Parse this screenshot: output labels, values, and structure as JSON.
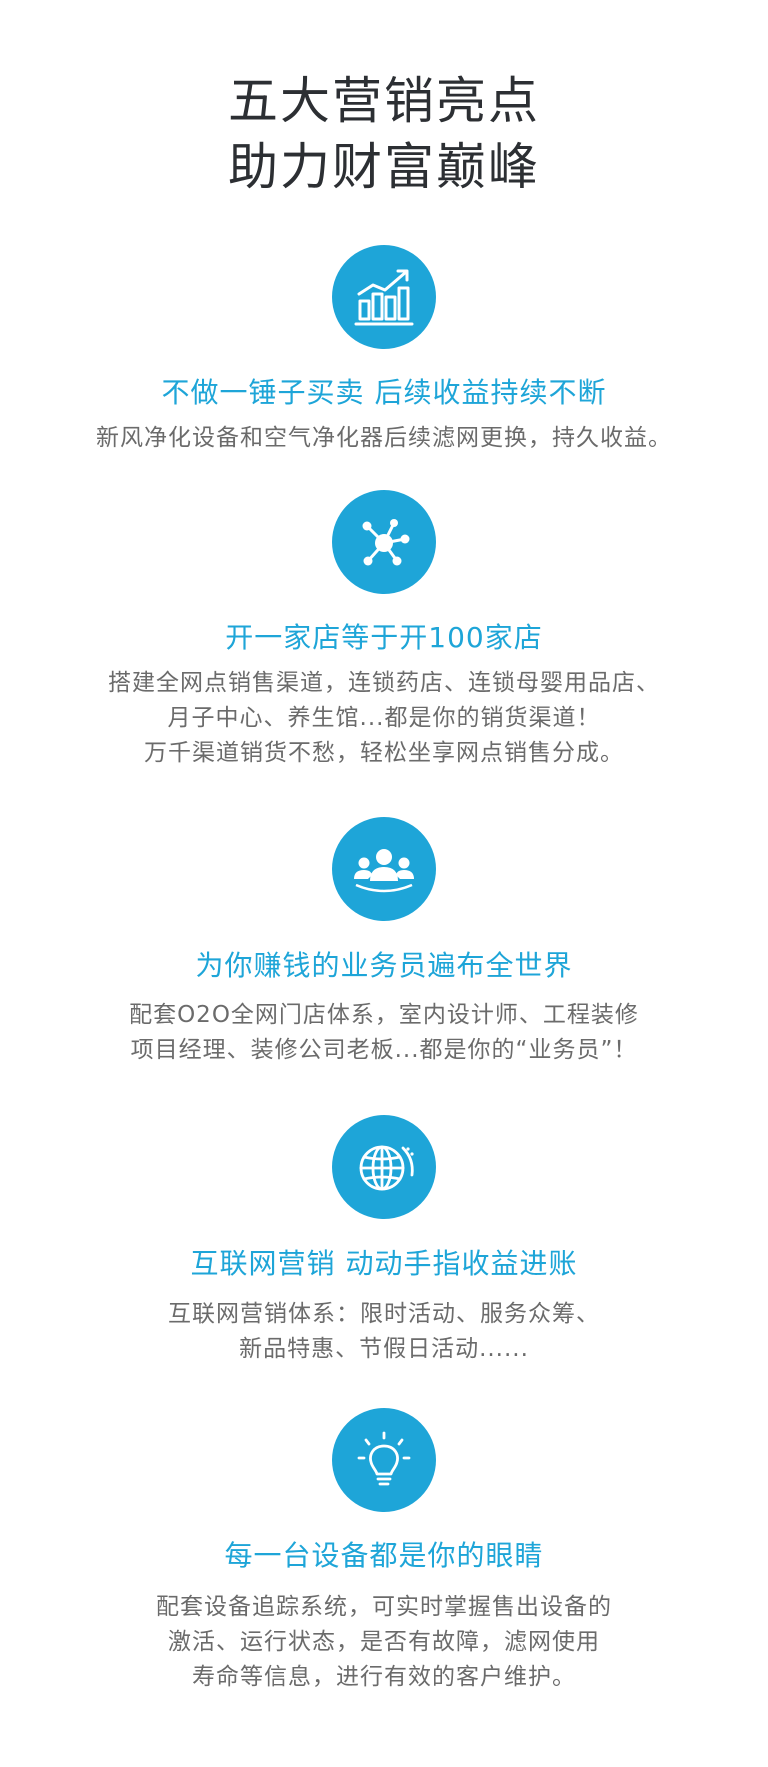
{
  "header": {
    "line1": "五大营销亮点",
    "line2": "助力财富巅峰"
  },
  "colors": {
    "accent": "#1ea5d8",
    "title_text": "#2c2f33",
    "body_text": "#6b6b6b"
  },
  "features": [
    {
      "icon": "growth-chart-icon",
      "title": "不做一锤子买卖 后续收益持续不断",
      "lines": [
        "新风净化设备和空气净化器后续滤网更换，持久收益。"
      ]
    },
    {
      "icon": "network-nodes-icon",
      "title": "开一家店等于开100家店",
      "lines": [
        "搭建全网点销售渠道，连锁药店、连锁母婴用品店、",
        "月子中心、养生馆...都是你的销货渠道！",
        "万千渠道销货不愁，轻松坐享网点销售分成。"
      ]
    },
    {
      "icon": "team-people-icon",
      "title": "为你赚钱的业务员遍布全世界",
      "lines": [
        "配套O2O全网门店体系，室内设计师、工程装修",
        "项目经理、装修公司老板...都是你的“业务员”！"
      ]
    },
    {
      "icon": "globe-icon",
      "title": "互联网营销 动动手指收益进账",
      "lines": [
        "互联网营销体系：限时活动、服务众筹、",
        "新品特惠、节假日活动......"
      ]
    },
    {
      "icon": "lightbulb-icon",
      "title": "每一台设备都是你的眼睛",
      "lines": [
        "配套设备追踪系统，可实时掌握售出设备的",
        "激活、运行状态，是否有故障，滤网使用",
        "寿命等信息，进行有效的客户维护。"
      ]
    }
  ]
}
